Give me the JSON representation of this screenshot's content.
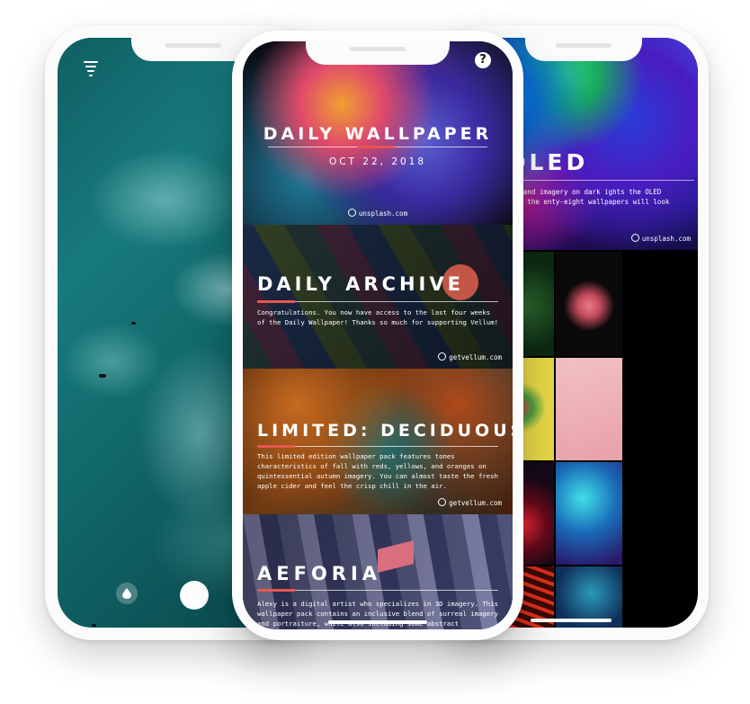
{
  "left_phone": {
    "icons": [
      "filter-icon",
      "drop-icon",
      "shutter-button"
    ]
  },
  "center_phone": {
    "help_label": "?",
    "cards": [
      {
        "title": "DAILY WALLPAPER",
        "date": "OCT 22, 2018",
        "credit": "unsplash.com"
      },
      {
        "title": "DAILY ARCHIVE",
        "description": "Congratulations. You now have access to the last four weeks of the Daily Wallpaper! Thanks so much for supporting Vellum!",
        "credit": "getvellum.com"
      },
      {
        "title": "LIMITED: DECIDUOUS",
        "description": "This limited edition wallpaper pack features tones characteristics of fall with reds, yellows, and oranges on quintessential autumn imagery. You can almost taste the fresh apple cider and feel the crisp chill in the air.",
        "credit": "getvellum.com"
      },
      {
        "title": "AEFORIA",
        "description": "Alexy is a digital artist who specializes in 3D imagery. This wallpaper pack contains an inclusive blend of surreal imagery and portraiture, while also including some abstract"
      }
    ]
  },
  "right_phone": {
    "title": "LÉ, OLED",
    "description": "tra-vibrant colors and imagery on dark ights the OLED technology found in the enty-eight wallpapers will look gorgeous",
    "credit": "unsplash.com"
  },
  "colors": {
    "accent": "#e8564f",
    "ocean": "#187a7c"
  }
}
